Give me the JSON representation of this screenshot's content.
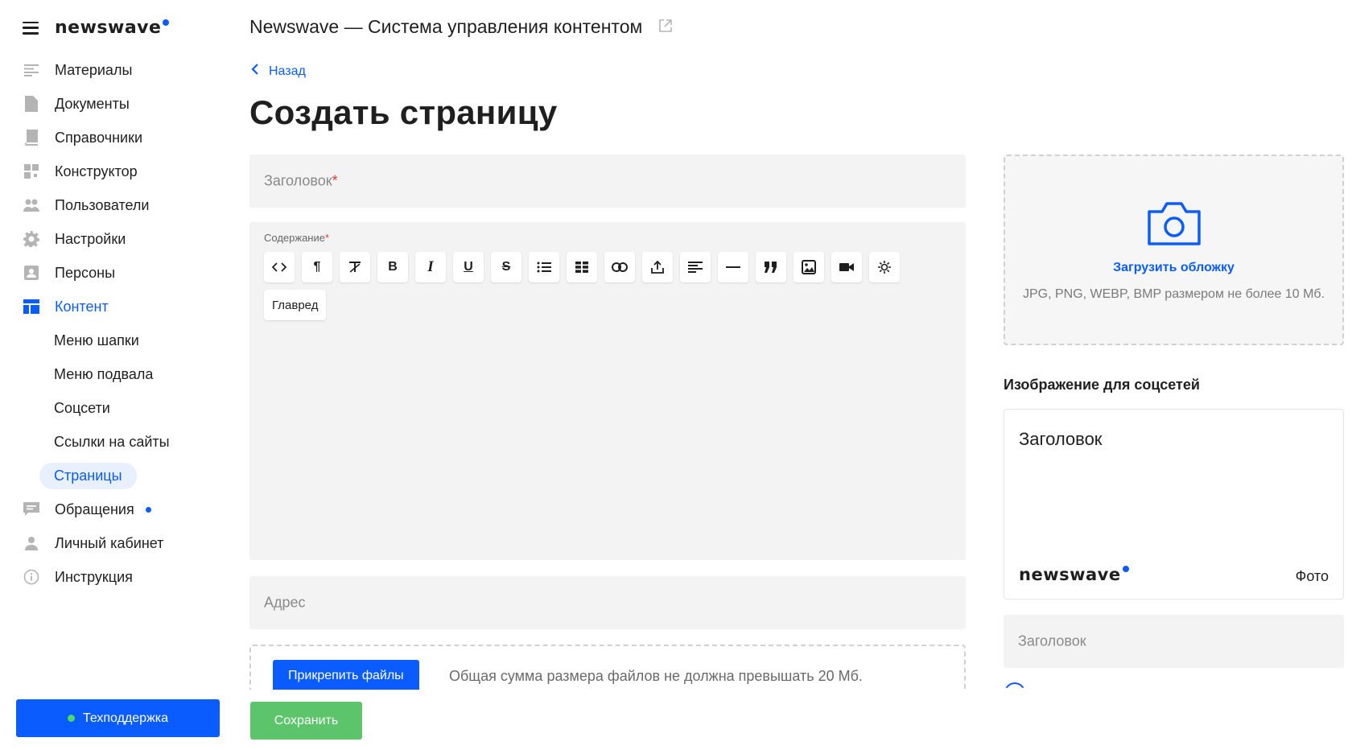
{
  "brand": {
    "name": "newswave"
  },
  "app_title": "Newswave — Система управления контентом",
  "nav": {
    "items": [
      {
        "label": "Материалы",
        "icon": "list-icon"
      },
      {
        "label": "Документы",
        "icon": "document-icon"
      },
      {
        "label": "Справочники",
        "icon": "book-icon"
      },
      {
        "label": "Конструктор",
        "icon": "grid-icon"
      },
      {
        "label": "Пользователи",
        "icon": "users-icon"
      },
      {
        "label": "Настройки",
        "icon": "gear-icon"
      },
      {
        "label": "Персоны",
        "icon": "person-card-icon"
      },
      {
        "label": "Контент",
        "icon": "layout-icon",
        "active": true
      }
    ],
    "sub_items": [
      {
        "label": "Меню шапки"
      },
      {
        "label": "Меню подвала"
      },
      {
        "label": "Соцсети"
      },
      {
        "label": "Ссылки на сайты"
      },
      {
        "label": "Страницы",
        "active": true
      }
    ],
    "bottom_items": [
      {
        "label": "Обращения",
        "icon": "chat-icon",
        "has_badge": true
      },
      {
        "label": "Личный кабинет",
        "icon": "user-icon"
      },
      {
        "label": "Инструкция",
        "icon": "info-icon"
      }
    ]
  },
  "support_button": "Техподдержка",
  "back_link": "Назад",
  "page_title": "Создать страницу",
  "form": {
    "title_placeholder": "Заголовок",
    "content_label": "Содержание",
    "required_mark": "*",
    "toolbar": [
      {
        "name": "code-view",
        "glyph": "<>"
      },
      {
        "name": "paragraph",
        "glyph": "¶"
      },
      {
        "name": "clear-format",
        "glyph": "T̸"
      },
      {
        "name": "bold",
        "glyph": "B"
      },
      {
        "name": "italic",
        "glyph": "I"
      },
      {
        "name": "underline",
        "glyph": "U"
      },
      {
        "name": "strikethrough",
        "glyph": "S"
      },
      {
        "name": "bullet-list",
        "glyph": "☰"
      },
      {
        "name": "table",
        "glyph": "▦"
      },
      {
        "name": "link",
        "glyph": "🔗"
      },
      {
        "name": "upload",
        "glyph": "⇪"
      },
      {
        "name": "align",
        "glyph": "≡"
      },
      {
        "name": "horizontal-rule",
        "glyph": "—"
      },
      {
        "name": "quote",
        "glyph": "❞"
      },
      {
        "name": "image",
        "glyph": "▣"
      },
      {
        "name": "video",
        "glyph": "■"
      },
      {
        "name": "special",
        "glyph": "☼"
      }
    ],
    "glavred_label": "Главред",
    "address_placeholder": "Адрес",
    "attach_button": "Прикрепить файлы",
    "attach_note": "Общая сумма размера файлов не должна превышать 20 Мб.",
    "save_button": "Сохранить"
  },
  "cover": {
    "upload_label": "Загрузить обложку",
    "upload_note": "JPG, PNG, WEBP, BMP размером не более 10 Мб."
  },
  "social": {
    "section_title": "Изображение для соцсетей",
    "preview_title": "Заголовок",
    "preview_brand": "newswave",
    "preview_photo": "Фото",
    "title_placeholder": "Заголовок"
  },
  "colors": {
    "accent": "#0a5cff",
    "save": "#5cc46a",
    "field_bg": "#f3f3f3"
  }
}
